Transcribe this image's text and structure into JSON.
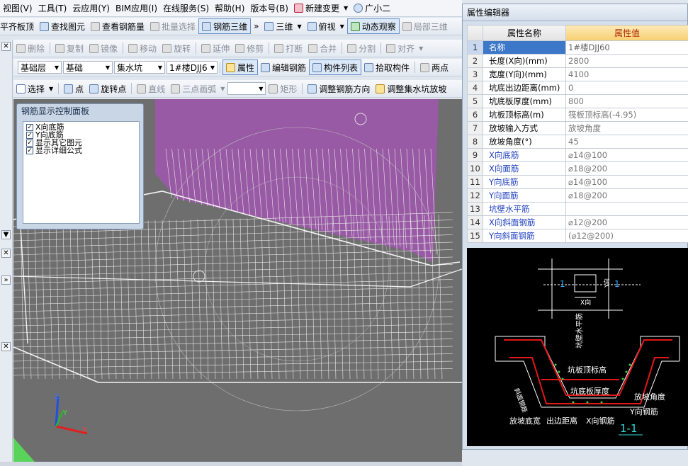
{
  "menu": [
    "视图(V)",
    "工具(T)",
    "云应用(Y)",
    "BIM应用(I)",
    "在线服务(S)",
    "帮助(H)",
    "版本号(B)",
    "新建变更",
    "广小二"
  ],
  "toolbar1": {
    "items": [
      "平齐板顶",
      "查找图元",
      "查看钢筋量",
      "批量选择",
      "钢筋三维",
      "三维",
      "俯视",
      "动态观察",
      "局部三维"
    ]
  },
  "toolbar2": {
    "items": [
      "删除",
      "复制",
      "镜像",
      "移动",
      "旋转",
      "延伸",
      "修剪",
      "打断",
      "合并",
      "分割",
      "对齐"
    ]
  },
  "toolbar3": {
    "floor": "基础层",
    "category": "基础",
    "type": "集水坑",
    "component": "1#楼DJJ6",
    "items": [
      "属性",
      "编辑钢筋",
      "构件列表",
      "拾取构件",
      "两点"
    ]
  },
  "toolbar4": {
    "items": [
      "选择",
      "点",
      "旋转点",
      "直线",
      "三点画弧",
      "矩形",
      "调整钢筋方向",
      "调整集水坑放坡"
    ]
  },
  "rebar_panel": {
    "title": "钢筋显示控制面板",
    "options": [
      {
        "label": "X向底筋",
        "checked": true
      },
      {
        "label": "Y向底筋",
        "checked": true
      },
      {
        "label": "显示其它图元",
        "checked": true
      },
      {
        "label": "显示详细公式",
        "checked": true
      }
    ]
  },
  "property_editor": {
    "title": "属性编辑器",
    "col_name": "属性名称",
    "col_value": "属性值",
    "rows": [
      {
        "n": "1",
        "name": "名称",
        "value": "1#楼DJJ60",
        "blue": true
      },
      {
        "n": "2",
        "name": "长度(X向)(mm)",
        "value": "2800",
        "blue": false
      },
      {
        "n": "3",
        "name": "宽度(Y向)(mm)",
        "value": "4100",
        "blue": false
      },
      {
        "n": "4",
        "name": "坑底出边距离(mm)",
        "value": "0",
        "blue": false
      },
      {
        "n": "5",
        "name": "坑底板厚度(mm)",
        "value": "800",
        "blue": false
      },
      {
        "n": "6",
        "name": "坑板顶标高(m)",
        "value": "筏板顶标高(-4.95)",
        "blue": false
      },
      {
        "n": "7",
        "name": "放坡输入方式",
        "value": "放坡角度",
        "blue": false
      },
      {
        "n": "8",
        "name": "放坡角度(°)",
        "value": "45",
        "blue": false
      },
      {
        "n": "9",
        "name": "X向底筋",
        "value": "⌀14@100",
        "blue": true
      },
      {
        "n": "10",
        "name": "X向面筋",
        "value": "⌀18@200",
        "blue": true
      },
      {
        "n": "11",
        "name": "Y向底筋",
        "value": "⌀14@100",
        "blue": true
      },
      {
        "n": "12",
        "name": "Y向面筋",
        "value": "⌀18@200",
        "blue": true
      },
      {
        "n": "13",
        "name": "坑壁水平筋",
        "value": "",
        "blue": true
      },
      {
        "n": "14",
        "name": "X向斜面钢筋",
        "value": "⌀12@200",
        "blue": true
      },
      {
        "n": "15",
        "name": "Y向斜面钢筋",
        "value": "(⌀12@200)",
        "blue": true
      }
    ]
  },
  "sketch": {
    "labels": {
      "one_left": "1",
      "one_right": "1",
      "x_dir": "X向",
      "y_dir": "Y向",
      "wall_bar": "坑壁水平筋",
      "top_elev": "坑板顶标高",
      "slab_thick": "坑底板厚度",
      "slope_angle": "放坡角度",
      "y_rebar": "Y向钢筋",
      "slope_bottom_width": "放坡底宽",
      "out_dist": "出边距离",
      "x_rebar": "X向钢筋",
      "slope_rebar": "斜面钢筋",
      "section": "1-1"
    }
  },
  "axis": {
    "x": "X",
    "y": "Y",
    "z": "Z"
  },
  "colors": {
    "accent": "#3c77c8",
    "pit": "#9b59a8",
    "value_header": "#f7cf72"
  }
}
